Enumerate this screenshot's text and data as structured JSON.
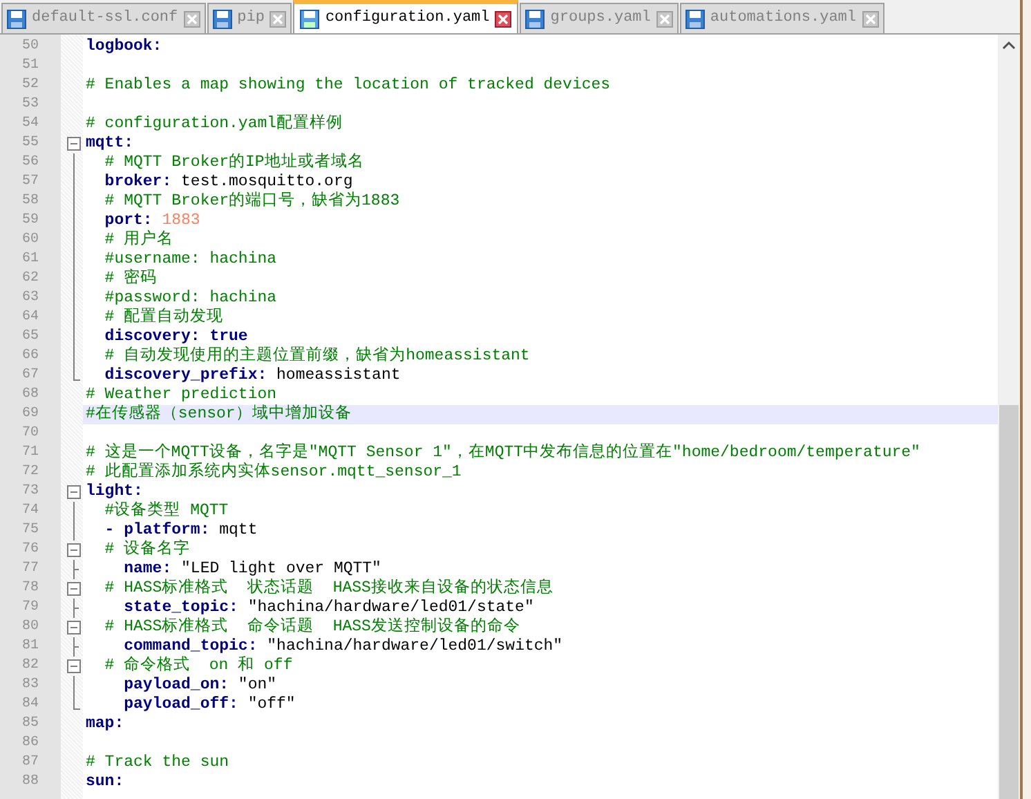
{
  "tabs": [
    {
      "label": "default-ssl.conf",
      "selected": false
    },
    {
      "label": "pip",
      "selected": false
    },
    {
      "label": "configuration.yaml",
      "selected": true
    },
    {
      "label": "groups.yaml",
      "selected": false
    },
    {
      "label": "automations.yaml",
      "selected": false
    }
  ],
  "lines": [
    {
      "number": "50",
      "kind": "plain",
      "current": false,
      "tokens": [
        {
          "kind": "key",
          "text": "logbook:"
        }
      ]
    },
    {
      "number": "51",
      "kind": "plain",
      "current": false
    },
    {
      "number": "52",
      "kind": "plain",
      "current": false,
      "tokens": [
        {
          "kind": "comment",
          "text": "# Enables a map showing the location of tracked devices"
        }
      ]
    },
    {
      "number": "53",
      "kind": "plain",
      "current": false
    },
    {
      "number": "54",
      "kind": "plain",
      "current": false,
      "tokens": [
        {
          "kind": "comment",
          "text": "# configuration.yaml配置样例"
        }
      ]
    },
    {
      "number": "55",
      "kind": "fold_open",
      "current": false,
      "tokens": [
        {
          "kind": "key",
          "text": "mqtt:"
        }
      ]
    },
    {
      "number": "56",
      "kind": "fold_line",
      "current": false,
      "tokens": [
        {
          "kind": "comment",
          "text": "  # MQTT Broker的IP地址或者域名"
        }
      ]
    },
    {
      "number": "57",
      "kind": "fold_line",
      "current": false,
      "tokens": [
        {
          "kind": "key",
          "text": "  broker:"
        },
        {
          "kind": "value",
          "text": " test.mosquitto.org"
        }
      ]
    },
    {
      "number": "58",
      "kind": "fold_line",
      "current": false,
      "tokens": [
        {
          "kind": "comment",
          "text": "  # MQTT Broker的端口号，缺省为1883"
        }
      ]
    },
    {
      "number": "59",
      "kind": "fold_line",
      "current": false,
      "tokens": [
        {
          "kind": "key",
          "text": "  port:"
        },
        {
          "kind": "number",
          "text": " 1883"
        }
      ]
    },
    {
      "number": "60",
      "kind": "fold_line",
      "current": false,
      "tokens": [
        {
          "kind": "comment",
          "text": "  # 用户名"
        }
      ]
    },
    {
      "number": "61",
      "kind": "fold_line",
      "current": false,
      "tokens": [
        {
          "kind": "comment",
          "text": "  #username: hachina"
        }
      ]
    },
    {
      "number": "62",
      "kind": "fold_line",
      "current": false,
      "tokens": [
        {
          "kind": "comment",
          "text": "  # 密码"
        }
      ]
    },
    {
      "number": "63",
      "kind": "fold_line",
      "current": false,
      "tokens": [
        {
          "kind": "comment",
          "text": "  #password: hachina"
        }
      ]
    },
    {
      "number": "64",
      "kind": "fold_line",
      "current": false,
      "tokens": [
        {
          "kind": "comment",
          "text": "  # 配置自动发现"
        }
      ]
    },
    {
      "number": "65",
      "kind": "fold_line",
      "current": false,
      "tokens": [
        {
          "kind": "key",
          "text": "  discovery:"
        },
        {
          "kind": "keyword",
          "text": " true"
        }
      ]
    },
    {
      "number": "66",
      "kind": "fold_line",
      "current": false,
      "tokens": [
        {
          "kind": "comment",
          "text": "  # 自动发现使用的主题位置前缀，缺省为homeassistant"
        }
      ]
    },
    {
      "number": "67",
      "kind": "fold_end",
      "current": false,
      "tokens": [
        {
          "kind": "key",
          "text": "  discovery_prefix:"
        },
        {
          "kind": "value",
          "text": " homeassistant"
        }
      ]
    },
    {
      "number": "68",
      "kind": "plain",
      "current": false,
      "tokens": [
        {
          "kind": "comment",
          "text": "# Weather prediction"
        }
      ]
    },
    {
      "number": "69",
      "kind": "plain",
      "current": true,
      "tokens": [
        {
          "kind": "comment",
          "text": "#在传感器（sensor）域中增加设备"
        }
      ]
    },
    {
      "number": "70",
      "kind": "plain",
      "current": false
    },
    {
      "number": "71",
      "kind": "plain",
      "current": false,
      "tokens": [
        {
          "kind": "comment",
          "text": "# 这是一个MQTT设备，名字是\"MQTT Sensor 1\"，在MQTT中发布信息的位置在\"home/bedroom/temperature\""
        }
      ]
    },
    {
      "number": "72",
      "kind": "plain",
      "current": false,
      "tokens": [
        {
          "kind": "comment",
          "text": "# 此配置添加系统内实体sensor.mqtt_sensor_1"
        }
      ]
    },
    {
      "number": "73",
      "kind": "fold_open",
      "current": false,
      "tokens": [
        {
          "kind": "key",
          "text": "light:"
        }
      ]
    },
    {
      "number": "74",
      "kind": "fold_line",
      "current": false,
      "tokens": [
        {
          "kind": "comment",
          "text": "  #设备类型 MQTT"
        }
      ]
    },
    {
      "number": "75",
      "kind": "fold_line",
      "current": false,
      "tokens": [
        {
          "kind": "key",
          "text": "  - platform:"
        },
        {
          "kind": "value",
          "text": " mqtt"
        }
      ]
    },
    {
      "number": "76",
      "kind": "fold_open",
      "current": false,
      "tokens": [
        {
          "kind": "comment",
          "text": "  # 设备名字"
        }
      ]
    },
    {
      "number": "77",
      "kind": "fold_branch",
      "current": false,
      "tokens": [
        {
          "kind": "key",
          "text": "    name:"
        },
        {
          "kind": "value",
          "text": " \"LED light over MQTT\""
        }
      ]
    },
    {
      "number": "78",
      "kind": "fold_open",
      "current": false,
      "tokens": [
        {
          "kind": "comment",
          "text": "  # HASS标准格式  状态话题  HASS接收来自设备的状态信息"
        }
      ]
    },
    {
      "number": "79",
      "kind": "fold_branch",
      "current": false,
      "tokens": [
        {
          "kind": "key",
          "text": "    state_topic:"
        },
        {
          "kind": "value",
          "text": " \"hachina/hardware/led01/state\""
        }
      ]
    },
    {
      "number": "80",
      "kind": "fold_open",
      "current": false,
      "tokens": [
        {
          "kind": "comment",
          "text": "  # HASS标准格式  命令话题  HASS发送控制设备的命令"
        }
      ]
    },
    {
      "number": "81",
      "kind": "fold_branch",
      "current": false,
      "tokens": [
        {
          "kind": "key",
          "text": "    command_topic:"
        },
        {
          "kind": "value",
          "text": " \"hachina/hardware/led01/switch\""
        }
      ]
    },
    {
      "number": "82",
      "kind": "fold_open",
      "current": false,
      "tokens": [
        {
          "kind": "comment",
          "text": "  # 命令格式  on 和 off"
        }
      ]
    },
    {
      "number": "83",
      "kind": "fold_line",
      "current": false,
      "tokens": [
        {
          "kind": "key",
          "text": "    payload_on:"
        },
        {
          "kind": "value",
          "text": " \"on\""
        }
      ]
    },
    {
      "number": "84",
      "kind": "fold_end",
      "current": false,
      "tokens": [
        {
          "kind": "key",
          "text": "    payload_off:"
        },
        {
          "kind": "value",
          "text": " \"off\""
        }
      ]
    },
    {
      "number": "85",
      "kind": "plain",
      "current": false,
      "tokens": [
        {
          "kind": "key",
          "text": "map:"
        }
      ]
    },
    {
      "number": "86",
      "kind": "plain",
      "current": false
    },
    {
      "number": "87",
      "kind": "plain",
      "current": false,
      "tokens": [
        {
          "kind": "comment",
          "text": "# Track the sun"
        }
      ]
    },
    {
      "number": "88",
      "kind": "plain",
      "current": false,
      "tokens": [
        {
          "kind": "key",
          "text": "sun:"
        }
      ]
    }
  ]
}
